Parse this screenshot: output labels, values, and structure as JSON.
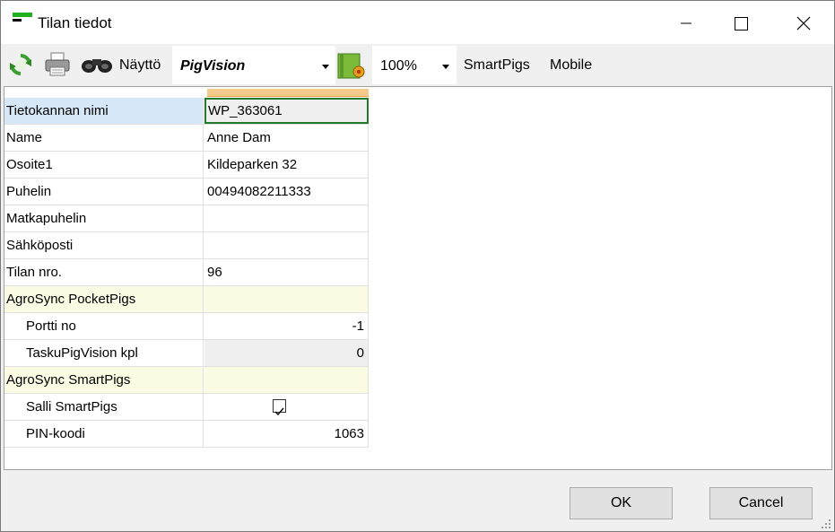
{
  "window": {
    "title": "Tilan tiedot"
  },
  "toolbar": {
    "naytto_label": "Näyttö",
    "view_value": "PigVision",
    "zoom_value": "100%",
    "smartpigs_label": "SmartPigs",
    "mobile_label": "Mobile"
  },
  "grid": {
    "rows": [
      {
        "label": "Tietokannan nimi",
        "value": "WP_363061"
      },
      {
        "label": "Name",
        "value": "Anne Dam"
      },
      {
        "label": "Osoite1",
        "value": "Kildeparken 32"
      },
      {
        "label": "Puhelin",
        "value": "00494082211333"
      },
      {
        "label": "Matkapuhelin",
        "value": ""
      },
      {
        "label": "Sähköposti",
        "value": ""
      },
      {
        "label": "Tilan nro.",
        "value": "96"
      },
      {
        "label": "AgroSync PocketPigs",
        "value": ""
      },
      {
        "label": "Portti no",
        "value": "-1"
      },
      {
        "label": "TaskuPigVision kpl",
        "value": "0"
      },
      {
        "label": "AgroSync SmartPigs",
        "value": ""
      },
      {
        "label": "Salli SmartPigs",
        "checked": true
      },
      {
        "label": "PIN-koodi",
        "value": "1063"
      }
    ]
  },
  "buttons": {
    "ok": "OK",
    "cancel": "Cancel"
  },
  "colors": {
    "selection_border": "#217a2c",
    "category_bg": "#fbfbe4",
    "selected_label_bg": "#d6e8f7"
  }
}
